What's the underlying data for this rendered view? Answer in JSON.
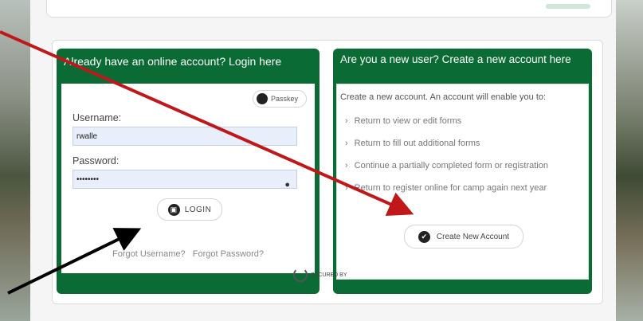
{
  "login_panel": {
    "title": "Already have an online account? Login here",
    "keys_button": "Passkey",
    "username_label": "Username:",
    "username_value": "rwalle",
    "password_label": "Password:",
    "password_value": "••••••••",
    "login_button": "LOGIN",
    "forgot_username": "Forgot Username?",
    "forgot_password": "Forgot Password?"
  },
  "create_panel": {
    "title": "Are you a new user? Create a new account here",
    "intro": "Create a new account. An account will enable you to:",
    "bullets": [
      "Return to view or edit forms",
      "Return to fill out additional forms",
      "Continue a partially completed form or registration",
      "Return to register online for camp again next year"
    ],
    "create_button": "Create New Account"
  },
  "footer": {
    "secured_by": "SECURED BY"
  },
  "colors": {
    "panel_green": "#0b6b35",
    "arrow_red": "#c0181a",
    "arrow_black": "#000000"
  }
}
